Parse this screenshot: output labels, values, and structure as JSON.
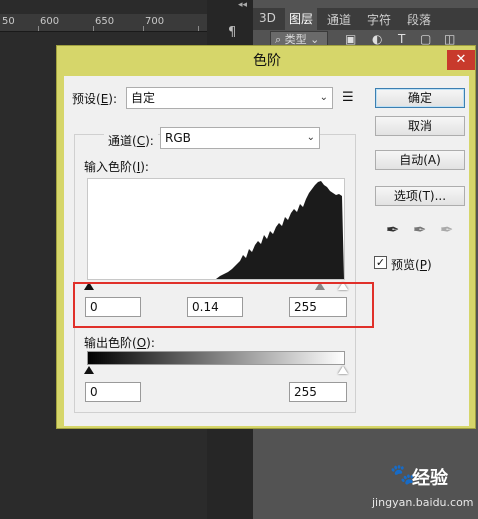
{
  "ps": {
    "ruler_ticks": [
      "50",
      "600",
      "650",
      "700"
    ],
    "panel_tabs": [
      "3D",
      "图层",
      "通道",
      "字符",
      "段落"
    ],
    "type_filter": "类型",
    "top_arrows": "◂◂"
  },
  "dialog": {
    "title": "色阶",
    "close_glyph": "✕",
    "preset_label": "预设",
    "preset_key": "E",
    "preset_value": "自定",
    "channel_label": "通道",
    "channel_key": "C",
    "channel_value": "RGB",
    "input_label": "输入色阶",
    "input_key": "I",
    "input_black": "0",
    "input_gamma": "0.14",
    "input_white": "255",
    "output_label": "输出色阶",
    "output_key": "O",
    "output_black": "0",
    "output_white": "255",
    "buttons": {
      "ok": "确定",
      "cancel": "取消",
      "auto": "自动(A)",
      "options": "选项(T)..."
    },
    "preview_label": "预览",
    "preview_key": "P",
    "preview_checked": true
  },
  "watermark": {
    "brand": "经验",
    "url": "jingyan.baidu.com"
  },
  "colors": {
    "dialog_frame": "#d6d66a",
    "highlight": "#e0302a",
    "close": "#c83a2c"
  }
}
